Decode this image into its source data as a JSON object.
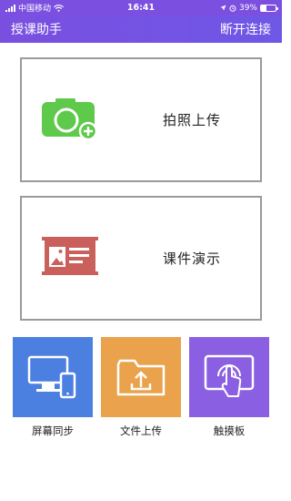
{
  "status": {
    "carrier": "中国移动",
    "time": "16:41",
    "battery": "39%",
    "battery_level": 0.39
  },
  "nav": {
    "title": "授课助手",
    "action": "断开连接"
  },
  "cards": {
    "photo_upload": "拍照上传",
    "presentation": "课件演示"
  },
  "tiles": {
    "screen_sync": "屏幕同步",
    "file_upload": "文件上传",
    "touchpad": "触摸板"
  },
  "colors": {
    "header": "#7a4fe0",
    "camera_green": "#5ec94a",
    "presentation_red": "#c9605c",
    "tile_blue": "#4b7fe0",
    "tile_orange": "#eaa24c",
    "tile_purple": "#8b5fe1"
  }
}
